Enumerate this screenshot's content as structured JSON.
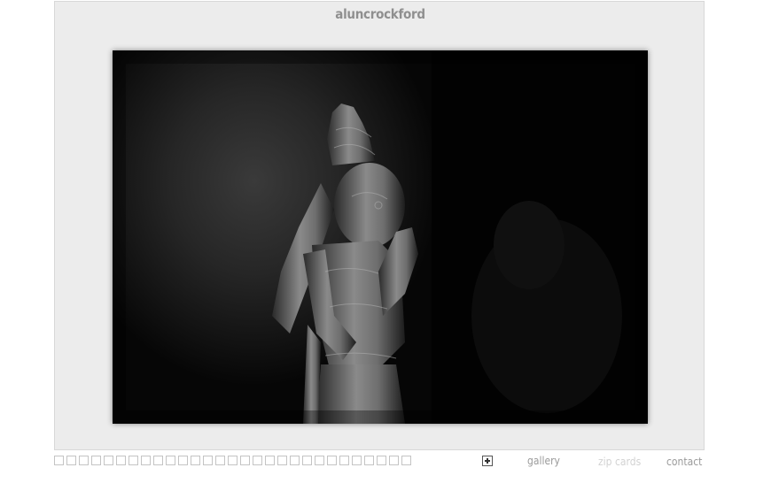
{
  "header": {
    "site_title": "aluncrockford"
  },
  "main": {
    "photo": {
      "subject": "carved-statue-photo",
      "style": "black-and-white"
    }
  },
  "thumbnails": {
    "count": 29,
    "more_icon": "plus-icon"
  },
  "nav": {
    "gallery_label": "gallery",
    "zip_cards_label": "zip cards",
    "contact_label": "contact"
  },
  "colors": {
    "frame_background": "#ececec",
    "title_color": "#8f8f8f",
    "link_color": "#9a9a9a",
    "dim_link_color": "#d2d2d2",
    "photo_background": "#050505"
  }
}
